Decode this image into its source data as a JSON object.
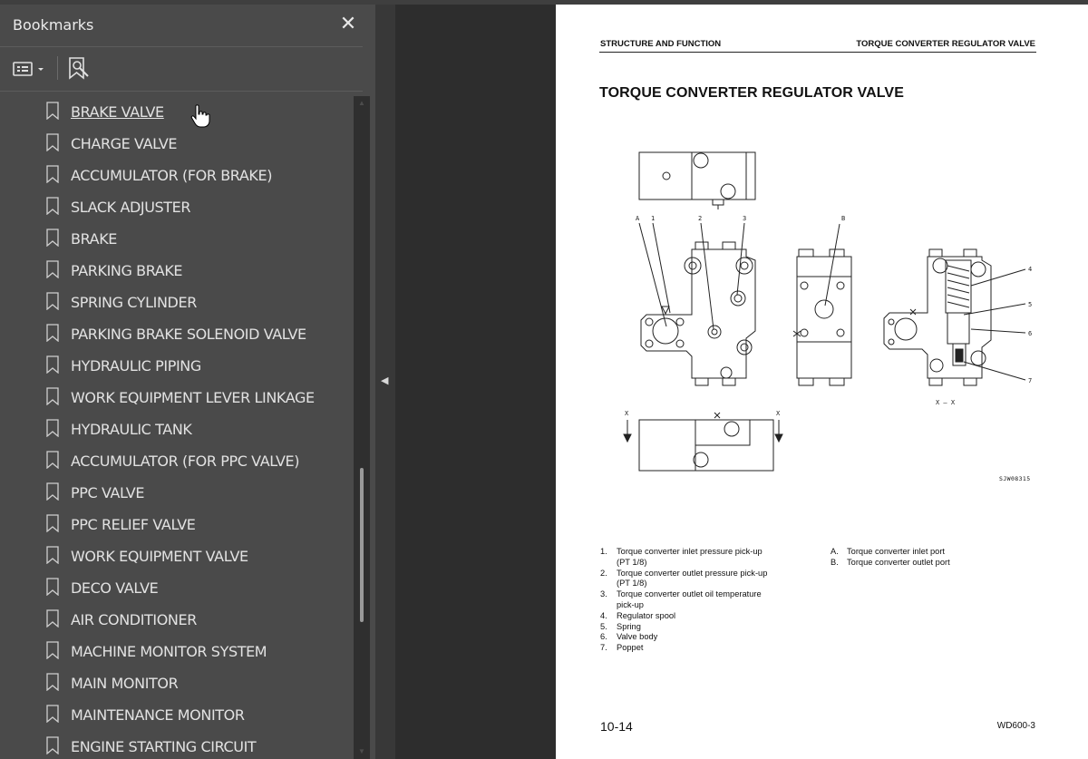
{
  "sidebar": {
    "title": "Bookmarks",
    "close_icon": "close-icon",
    "options_icon": "bookmark-options-icon",
    "find_icon": "find-bookmark-icon",
    "items": [
      {
        "label": "BRAKE VALVE",
        "active": true
      },
      {
        "label": "CHARGE VALVE"
      },
      {
        "label": "ACCUMULATOR (FOR BRAKE)"
      },
      {
        "label": "SLACK ADJUSTER"
      },
      {
        "label": "BRAKE"
      },
      {
        "label": "PARKING BRAKE"
      },
      {
        "label": "SPRING CYLINDER"
      },
      {
        "label": "PARKING BRAKE SOLENOID VALVE"
      },
      {
        "label": "HYDRAULIC PIPING"
      },
      {
        "label": "WORK EQUIPMENT LEVER LINKAGE"
      },
      {
        "label": "HYDRAULIC TANK"
      },
      {
        "label": "ACCUMULATOR (FOR PPC VALVE)"
      },
      {
        "label": "PPC VALVE"
      },
      {
        "label": "PPC RELIEF VALVE"
      },
      {
        "label": "WORK EQUIPMENT VALVE"
      },
      {
        "label": "DECO VALVE"
      },
      {
        "label": "AIR CONDITIONER"
      },
      {
        "label": "MACHINE MONITOR SYSTEM"
      },
      {
        "label": "MAIN MONITOR"
      },
      {
        "label": "MAINTENANCE MONITOR"
      },
      {
        "label": "ENGINE STARTING CIRCUIT"
      }
    ]
  },
  "document": {
    "running_head_left": "STRUCTURE AND FUNCTION",
    "running_head_right": "TORQUE CONVERTER REGULATOR VALVE",
    "title": "TORQUE CONVERTER REGULATOR VALVE",
    "figure": {
      "callouts": [
        "A",
        "1",
        "2",
        "3",
        "B",
        "4",
        "5",
        "6",
        "7"
      ],
      "section_label": "X – X",
      "section_mark": "X",
      "code": "SJW08315"
    },
    "legend_numbered": [
      {
        "num": "1.",
        "text": "Torque converter inlet pressure pick-up",
        "sub": "(PT 1/8)"
      },
      {
        "num": "2.",
        "text": "Torque converter outlet pressure pick-up",
        "sub": "(PT 1/8)"
      },
      {
        "num": "3.",
        "text": "Torque converter outlet oil temperature",
        "sub": "pick-up"
      },
      {
        "num": "4.",
        "text": "Regulator spool"
      },
      {
        "num": "5.",
        "text": "Spring"
      },
      {
        "num": "6.",
        "text": "Valve body"
      },
      {
        "num": "7.",
        "text": "Poppet"
      }
    ],
    "legend_lettered": [
      {
        "num": "A.",
        "text": "Torque converter inlet port"
      },
      {
        "num": "B.",
        "text": "Torque converter outlet port"
      }
    ],
    "page_number": "10-14",
    "model": "WD600-3"
  }
}
